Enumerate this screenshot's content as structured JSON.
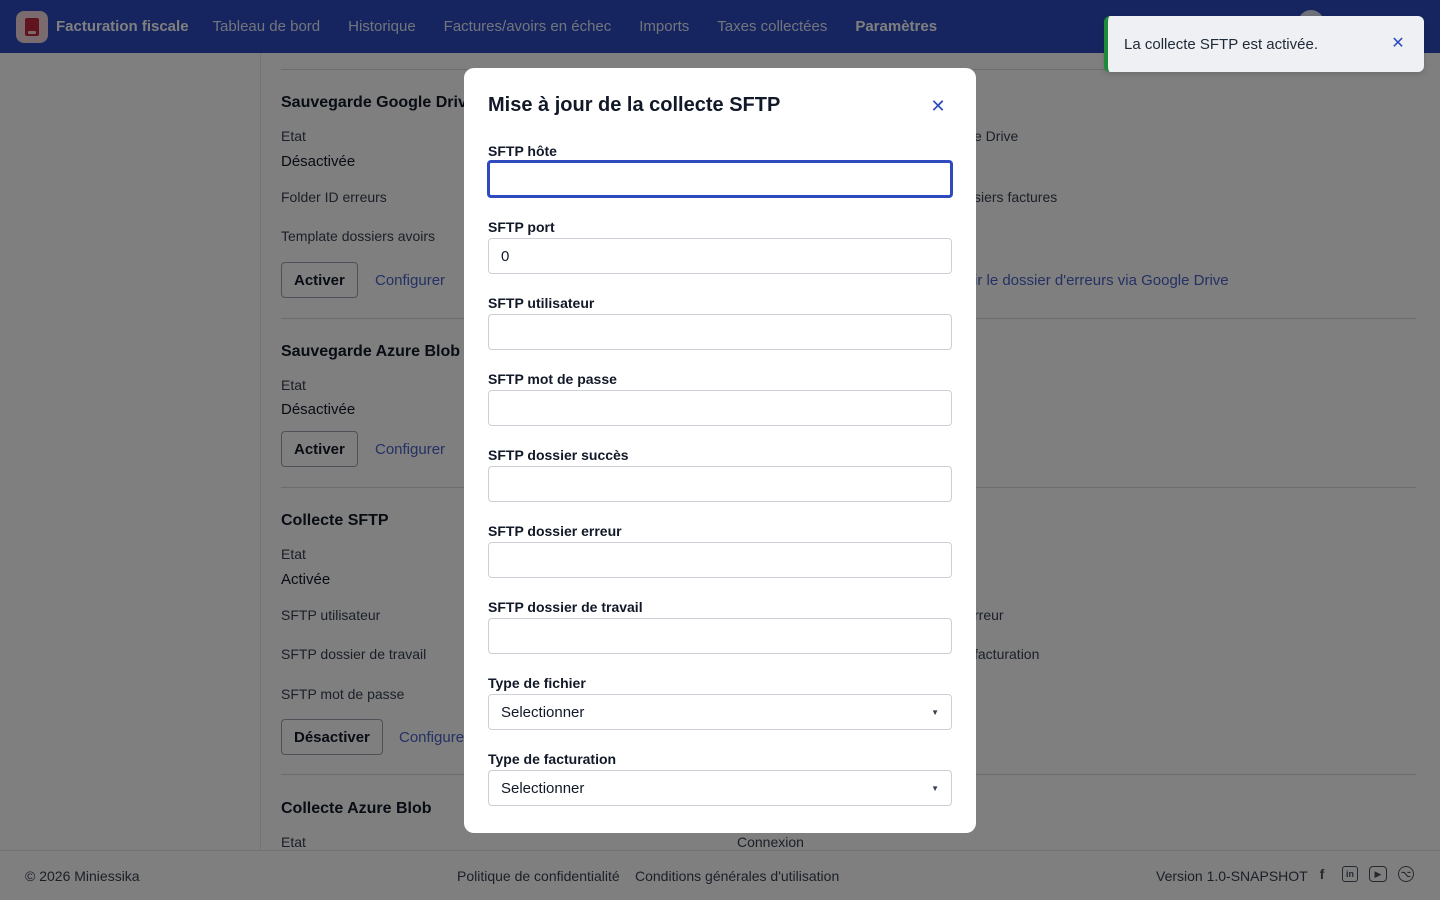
{
  "nav": {
    "brand": "Facturation fiscale",
    "items": [
      {
        "label": "Tableau de bord"
      },
      {
        "label": "Historique"
      },
      {
        "label": "Factures/avoirs en échec"
      },
      {
        "label": "Imports"
      },
      {
        "label": "Taxes collectées"
      },
      {
        "label": "Paramètres",
        "active": true
      }
    ]
  },
  "background": {
    "google_drive": {
      "title": "Sauvegarde Google Drive",
      "etat_label": "Etat",
      "etat_value": "Désactivée",
      "folder_errors_label": "Folder ID erreurs",
      "template_avoirs_label": "Template dossiers avoirs",
      "right_label_1": "e Drive",
      "right_label_2": "siers factures",
      "activate": "Activer",
      "configure": "Configurer",
      "open_errors_link": "ir le dossier d'erreurs via Google Drive"
    },
    "azure_backup": {
      "title": "Sauvegarde Azure Blob",
      "etat_label": "Etat",
      "etat_value": "Désactivée",
      "activate": "Activer",
      "configure": "Configurer"
    },
    "sftp_collect": {
      "title": "Collecte SFTP",
      "etat_label": "Etat",
      "etat_value": "Activée",
      "user_label": "SFTP utilisateur",
      "workdir_label": "SFTP dossier de travail",
      "password_label": "SFTP mot de passe",
      "right_label_1": "rreur",
      "right_label_2": "facturation",
      "deactivate": "Désactiver",
      "configure": "Configure"
    },
    "azure_collect": {
      "title": "Collecte Azure Blob",
      "etat_label": "Etat",
      "connexion_label": "Connexion"
    }
  },
  "modal": {
    "title": "Mise à jour de la collecte SFTP",
    "fields": [
      {
        "label": "SFTP hôte",
        "value": ""
      },
      {
        "label": "SFTP port",
        "value": "0"
      },
      {
        "label": "SFTP utilisateur",
        "value": ""
      },
      {
        "label": "SFTP mot de passe",
        "value": ""
      },
      {
        "label": "SFTP dossier succès",
        "value": ""
      },
      {
        "label": "SFTP dossier erreur",
        "value": ""
      },
      {
        "label": "SFTP dossier de travail",
        "value": ""
      }
    ],
    "file_type": {
      "label": "Type de fichier",
      "selected": "Selectionner"
    },
    "billing_type": {
      "label": "Type de facturation",
      "selected": "Selectionner"
    }
  },
  "toast": {
    "message": "La collecte SFTP est activée."
  },
  "footer": {
    "copyright": "© 2026 Miniessika",
    "privacy": "Politique de confidentialité",
    "terms": "Conditions générales d'utilisation",
    "version": "Version 1.0-SNAPSHOT"
  },
  "icons": [
    "facebook-icon",
    "linkedin-icon",
    "youtube-icon",
    "github-icon"
  ],
  "colors": {
    "primary": "#2d4bbf",
    "success": "#1e8a3a"
  }
}
